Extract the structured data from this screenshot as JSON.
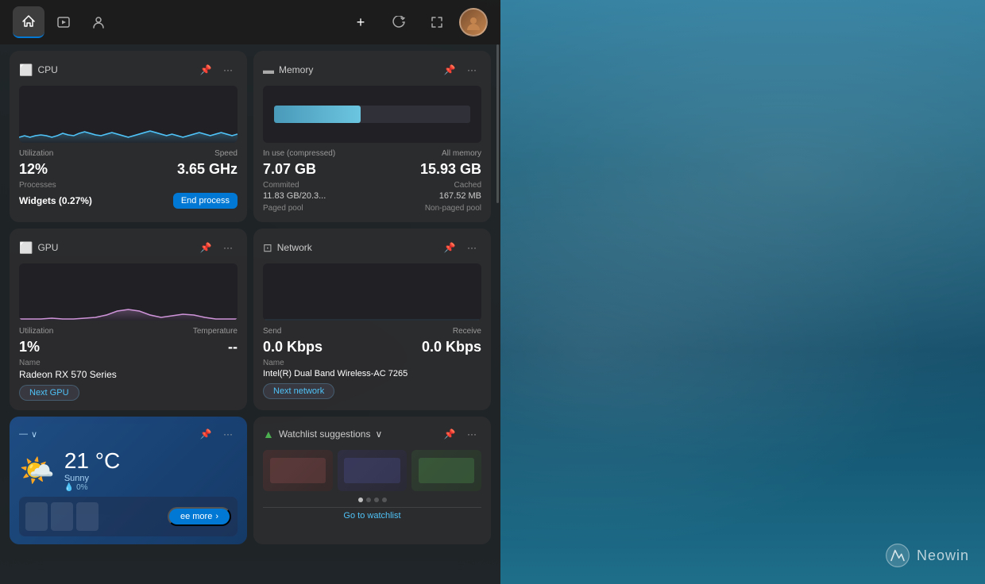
{
  "background": {
    "description": "Aerial coastal ocean landscape"
  },
  "neowin": {
    "text": "Neowin"
  },
  "topNav": {
    "addLabel": "+",
    "refreshLabel": "↻",
    "expandLabel": "⤢",
    "tabs": [
      {
        "id": "home",
        "icon": "⊞",
        "active": true
      },
      {
        "id": "media",
        "icon": "▶"
      },
      {
        "id": "person",
        "icon": "👤"
      }
    ]
  },
  "widgets": {
    "cpu": {
      "title": "CPU",
      "utilLabel": "Utilization",
      "speedLabel": "Speed",
      "utilValue": "12%",
      "speedValue": "3.65 GHz",
      "processesLabel": "Processes",
      "processName": "Widgets (0.27%)",
      "endProcessLabel": "End process",
      "chartData": [
        2,
        3,
        2,
        3,
        4,
        3,
        2,
        3,
        5,
        4,
        3,
        5,
        6,
        5,
        4,
        3,
        4,
        5,
        4,
        3,
        2,
        3,
        4,
        5,
        6,
        5,
        4,
        3,
        4,
        3,
        2,
        3,
        4,
        5,
        4,
        3,
        2,
        3,
        4,
        5
      ]
    },
    "memory": {
      "title": "Memory",
      "inUseLabel": "In use (compressed)",
      "allMemLabel": "All memory",
      "inUseValue": "7.07 GB",
      "allMemValue": "15.93 GB",
      "committedLabel": "Commited",
      "cachedLabel": "Cached",
      "committedValue": "11.83 GB/20.3...",
      "cachedValue": "167.52 MB",
      "pagedLabel": "Paged pool",
      "nonPagedLabel": "Non-paged pool",
      "fillPercent": 44
    },
    "gpu": {
      "title": "GPU",
      "utilLabel": "Utilization",
      "tempLabel": "Temperature",
      "utilValue": "1%",
      "tempValue": "--",
      "nameLabel": "Name",
      "nameValue": "Radeon RX 570 Series",
      "nextLabel": "Next GPU",
      "chartData": [
        1,
        1,
        1,
        2,
        1,
        1,
        2,
        3,
        4,
        5,
        6,
        5,
        7,
        8,
        7,
        6,
        5,
        4,
        5,
        6,
        5,
        4,
        3,
        2,
        3,
        4,
        3,
        2,
        1,
        1,
        2,
        1,
        1,
        2,
        1,
        1,
        1,
        1,
        1,
        1
      ]
    },
    "network": {
      "title": "Network",
      "sendLabel": "Send",
      "receiveLabel": "Receive",
      "sendValue": "0.0 Kbps",
      "receiveValue": "0.0 Kbps",
      "nameLabel": "Name",
      "nameValue": "Intel(R) Dual Band Wireless-AC 7265",
      "nextLabel": "Next network"
    },
    "weather": {
      "location": "—",
      "temp": "21 °C",
      "condition": "Sunny",
      "precipitation": "0%",
      "precipIcon": "💧",
      "icon": "🌤️",
      "seeMoreLabel": "ee more",
      "expandIcon": "›",
      "pinIcon": "📌",
      "moreIcon": "•••"
    },
    "watchlist": {
      "title": "Watchlist suggestions",
      "chevronIcon": "∨",
      "pinIcon": "📌",
      "moreIcon": "•••",
      "goLabel": "Go to watchlist",
      "dots": [
        1,
        2,
        3,
        4
      ],
      "activeDot": 0
    }
  }
}
